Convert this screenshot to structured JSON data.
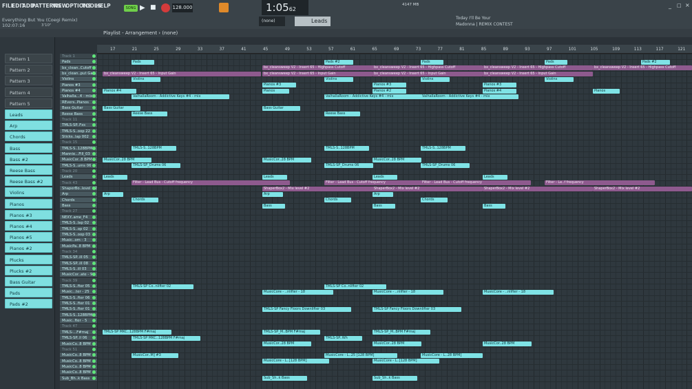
{
  "menu": [
    "FILE",
    "EDIT",
    "ADD",
    "PATTERNS",
    "VIEW",
    "OPTIONS",
    "TOOLS",
    "HELP"
  ],
  "song": {
    "name": "Everything But You (Coegi Remix)",
    "time": "102:07:16",
    "bpm": "128.000",
    "clock": "1:05",
    "clock_small": "62",
    "mode": "SONG",
    "cpu": "4147 MB",
    "cpu2": "3"
  },
  "hint": {
    "title": "Today  I'll Be Your",
    "sub": "Madonna | REMIX CONTEST"
  },
  "playlist": {
    "title": "Playlist - Arrangement",
    "scope": "(none)",
    "pattern": "Leads",
    "pattern_sel": "(none)"
  },
  "browser_top": {
    "time": "3'10\""
  },
  "patterns": [
    "Pattern 1",
    "Pattern 2",
    "Pattern 3",
    "Pattern 4",
    "Pattern 5",
    "Leads",
    "Arp",
    "Chords",
    "Bass",
    "Bass #2",
    "Reese Bass",
    "Reese Bass #2",
    "Violins",
    "Pianos",
    "Pianos #3",
    "Pianos #4",
    "Pianos #5",
    "Pianos #2",
    "Plucks",
    "Plucks #2",
    "Bass Guitar",
    "Pads",
    "Pads #2"
  ],
  "ruler": [
    "17",
    "21",
    "25",
    "29",
    "33",
    "37",
    "41",
    "45",
    "49",
    "53",
    "57",
    "61",
    "65",
    "69",
    "73",
    "77",
    "81",
    "85",
    "89",
    "93",
    "97",
    "101",
    "105",
    "109",
    "113",
    "117",
    "121"
  ],
  "tracks": [
    "Track 1",
    "Pads",
    "bx_clean..Cutoff",
    "bx_clean..put Gain",
    "Violins",
    "Pianos #3",
    "Pianos #4",
    "Valhalla...4 - mix",
    "REvers..Pianos",
    "Bass Guitar",
    "Reese Bass",
    "Track 11",
    "TMLS-SP..Fxs",
    "TMLS-S..oop 22",
    "Sticks..lap 002",
    "Track 15",
    "TMLS-S..128BPM",
    "Mannie...Fill_03",
    "MusicCor..8 BPM",
    "TMLS-S..ums 06",
    "Track 20",
    "Leads",
    "Track 43",
    "ShaperBo..level #2",
    "Arp",
    "Chords",
    "Bass",
    "Track 27",
    "NEXY..ame_F4",
    "TMLS-S..lap 02",
    "TMLS-S..op 02",
    "TMLS-S..oop 03",
    "Music..om - 3",
    "MusicPa..8 BPM",
    "Track 34",
    "TMLS-SP..ill 05",
    "TMLS-SP..ill 08",
    "TMLS-S..ill 03",
    "MusicCor..ate - 9",
    "Track 39",
    "TMLS-S..fter 05",
    "Music...ter - 25",
    "TMLS-S..fter 06",
    "TMLS-S..fter 01",
    "TMLS-S..fter 01",
    "TMLS-S..128BPM",
    "Music..fter - 5",
    "Track 47",
    "TMLS-...F#maj",
    "TMLS-SP..ll 06",
    "MusicCo..8 BPM",
    "Track 51",
    "MusicCo..8 BPM",
    "MusicCo..8 BPM",
    "MusicCo..8 BPM",
    "MusicCo..8 BPM",
    "Sub_Bh..k Bass"
  ],
  "clips": [
    {
      "row": 1,
      "c": "cyan",
      "t": "Pads"
    },
    {
      "row": 1,
      "c": "cyan",
      "t": "Pads #2"
    },
    {
      "row": 1,
      "c": "cyan",
      "t": "Pads"
    },
    {
      "row": 1,
      "c": "cyan",
      "t": "Pads"
    },
    {
      "row": 1,
      "c": "cyan",
      "t": "Pads #2"
    },
    {
      "row": 2,
      "c": "purple",
      "t": "bx_cleansweep V2 - Insert 65 - Highpass Cutoff"
    },
    {
      "row": 2,
      "c": "purple",
      "t": "bx_cleansweep V2 - Insert 65 - Highpass Cutoff"
    },
    {
      "row": 2,
      "c": "purple",
      "t": "bx_cleansweep V2 - Insert 65 - Highpass Cutoff"
    },
    {
      "row": 2,
      "c": "purple",
      "t": "bx_cleansweep V2 - Insert 65 - Highpass Cutoff"
    },
    {
      "row": 3,
      "c": "purple",
      "t": "bx_cleansweep V2 - Insert 65 - Input Gain"
    },
    {
      "row": 3,
      "c": "purple",
      "t": "bx_cleansweep V2 - Insert 65 - Input Gain"
    },
    {
      "row": 3,
      "c": "purple",
      "t": "bx_cleansweep V2 - Insert 65 - Input Gain"
    },
    {
      "row": 3,
      "c": "purple",
      "t": "bx_cleansweep V2 - Insert 65 - Input Gain"
    },
    {
      "row": 4,
      "c": "cyan",
      "t": "Violins"
    },
    {
      "row": 4,
      "c": "cyan",
      "t": "Violins"
    },
    {
      "row": 4,
      "c": "cyan",
      "t": "Violins"
    },
    {
      "row": 4,
      "c": "cyan",
      "t": "Violins"
    },
    {
      "row": 5,
      "c": "cyan",
      "t": "Pianos #3"
    },
    {
      "row": 5,
      "c": "cyan",
      "t": "Pianos #3"
    },
    {
      "row": 5,
      "c": "cyan",
      "t": "Pianos #3"
    },
    {
      "row": 6,
      "c": "cyan",
      "t": "Pianos #4"
    },
    {
      "row": 6,
      "c": "cyan",
      "t": "Pianos"
    },
    {
      "row": 6,
      "c": "cyan",
      "t": "Pianos #2"
    },
    {
      "row": 6,
      "c": "cyan",
      "t": "Pianos #4"
    },
    {
      "row": 6,
      "c": "cyan",
      "t": "Pianos"
    },
    {
      "row": 7,
      "c": "cyan",
      "t": "ValhallaRoom - Addictive Keys #4 - mix"
    },
    {
      "row": 7,
      "c": "cyan",
      "t": "ValhallaRoom - Addictive Keys #4 - mix"
    },
    {
      "row": 7,
      "c": "cyan",
      "t": "ValhallaRoom - Addictive Keys #4 - mix"
    },
    {
      "row": 9,
      "c": "cyan",
      "t": "Bass Guitar"
    },
    {
      "row": 9,
      "c": "cyan",
      "t": "Bass Guitar"
    },
    {
      "row": 10,
      "c": "cyan",
      "t": "Reese Bass"
    },
    {
      "row": 10,
      "c": "cyan",
      "t": "Reese Bass"
    },
    {
      "row": 16,
      "c": "cyan",
      "t": "TMLS-S..128BPM"
    },
    {
      "row": 16,
      "c": "cyan",
      "t": "TMLS-S..128BPM"
    },
    {
      "row": 16,
      "c": "cyan",
      "t": "TMLS-S..128BPM"
    },
    {
      "row": 18,
      "c": "cyan",
      "t": "MusicCor..28 BPM"
    },
    {
      "row": 18,
      "c": "cyan",
      "t": "MusicCor..28 BPM"
    },
    {
      "row": 18,
      "c": "cyan",
      "t": "MusicCor..28 BPM"
    },
    {
      "row": 19,
      "c": "cyan",
      "t": "TMLS-SP_Drums 06"
    },
    {
      "row": 19,
      "c": "cyan",
      "t": "TMLS-SP_Drums 06"
    },
    {
      "row": 19,
      "c": "cyan",
      "t": "TMLS-SP_Drums 06"
    },
    {
      "row": 21,
      "c": "cyan",
      "t": "Leads"
    },
    {
      "row": 21,
      "c": "cyan",
      "t": "Leads"
    },
    {
      "row": 21,
      "c": "cyan",
      "t": "Leads"
    },
    {
      "row": 21,
      "c": "cyan",
      "t": "Leads"
    },
    {
      "row": 22,
      "c": "purple",
      "t": "Filter - Lead Bus - Cutoff frequency"
    },
    {
      "row": 22,
      "c": "purple",
      "t": "Filter - Lead Bus - Cutoff frequency"
    },
    {
      "row": 22,
      "c": "purple",
      "t": "Filter - Lead Bus - Cutoff frequency"
    },
    {
      "row": 22,
      "c": "purple",
      "t": "Filter - Le..f frequency"
    },
    {
      "row": 23,
      "c": "purple",
      "t": "ShaperBox2 - Mix level #2"
    },
    {
      "row": 23,
      "c": "purple",
      "t": "ShaperBox2 - Mix level #2"
    },
    {
      "row": 23,
      "c": "purple",
      "t": "ShaperBox2 - Mix level #2"
    },
    {
      "row": 23,
      "c": "purple",
      "t": "ShaperBox2 - Mix level #2"
    },
    {
      "row": 24,
      "c": "cyan",
      "t": "Arp"
    },
    {
      "row": 24,
      "c": "cyan",
      "t": "Arp"
    },
    {
      "row": 24,
      "c": "cyan",
      "t": "Arp"
    },
    {
      "row": 25,
      "c": "cyan",
      "t": "Chords"
    },
    {
      "row": 25,
      "c": "cyan",
      "t": "Chords"
    },
    {
      "row": 25,
      "c": "cyan",
      "t": "Chords"
    },
    {
      "row": 26,
      "c": "cyan",
      "t": "Bass"
    },
    {
      "row": 26,
      "c": "cyan",
      "t": "Bass"
    },
    {
      "row": 26,
      "c": "cyan",
      "t": "Bass"
    },
    {
      "row": 40,
      "c": "cyan",
      "t": "TMLS-SP Co..nlifter 02"
    },
    {
      "row": 40,
      "c": "cyan",
      "t": "TMLS-SP Co..nlifter 02"
    },
    {
      "row": 41,
      "c": "cyan",
      "t": "MusicCore - ..nlifter - 18"
    },
    {
      "row": 41,
      "c": "cyan",
      "t": "MusicCore - ..nlifter - 18"
    },
    {
      "row": 41,
      "c": "cyan",
      "t": "MusicCore - ..nlifter - 18"
    },
    {
      "row": 44,
      "c": "cyan",
      "t": "TMLS-SP Fancy Floors Downlifter 03"
    },
    {
      "row": 44,
      "c": "cyan",
      "t": "TMLS-SP Fancy Floors Downlifter 03"
    },
    {
      "row": 48,
      "c": "cyan",
      "t": "TMLS-SP MKC..128BPM F#maj"
    },
    {
      "row": 48,
      "c": "cyan",
      "t": "TMLS-SP_M..BPM F#maj"
    },
    {
      "row": 48,
      "c": "cyan",
      "t": "TMLS-SP_M..BPM F#maj"
    },
    {
      "row": 49,
      "c": "cyan",
      "t": "TMLS-SP MKC..128BPM F#maj"
    },
    {
      "row": 49,
      "c": "cyan",
      "t": "TMLS-SP..Wh"
    },
    {
      "row": 50,
      "c": "cyan",
      "t": "MusicCor..28 BPM"
    },
    {
      "row": 50,
      "c": "cyan",
      "t": "MusicCor..28 BPM"
    },
    {
      "row": 50,
      "c": "cyan",
      "t": "MusicCor..28 BPM"
    },
    {
      "row": 52,
      "c": "cyan",
      "t": "MusicCor..M] #3"
    },
    {
      "row": 52,
      "c": "cyan",
      "t": "MusicCore - L..25 [128 BPM]"
    },
    {
      "row": 52,
      "c": "cyan",
      "t": "MusicCore - L..28 BPM]"
    },
    {
      "row": 53,
      "c": "cyan",
      "t": "MusicCore - L..[128 BPM]"
    },
    {
      "row": 53,
      "c": "cyan",
      "t": "MusicCore - L..[128 BPM]"
    },
    {
      "row": 56,
      "c": "cyan",
      "t": "Sub_Sh..k Bass"
    },
    {
      "row": 56,
      "c": "cyan",
      "t": "Sub_Sh..k Bass"
    }
  ]
}
